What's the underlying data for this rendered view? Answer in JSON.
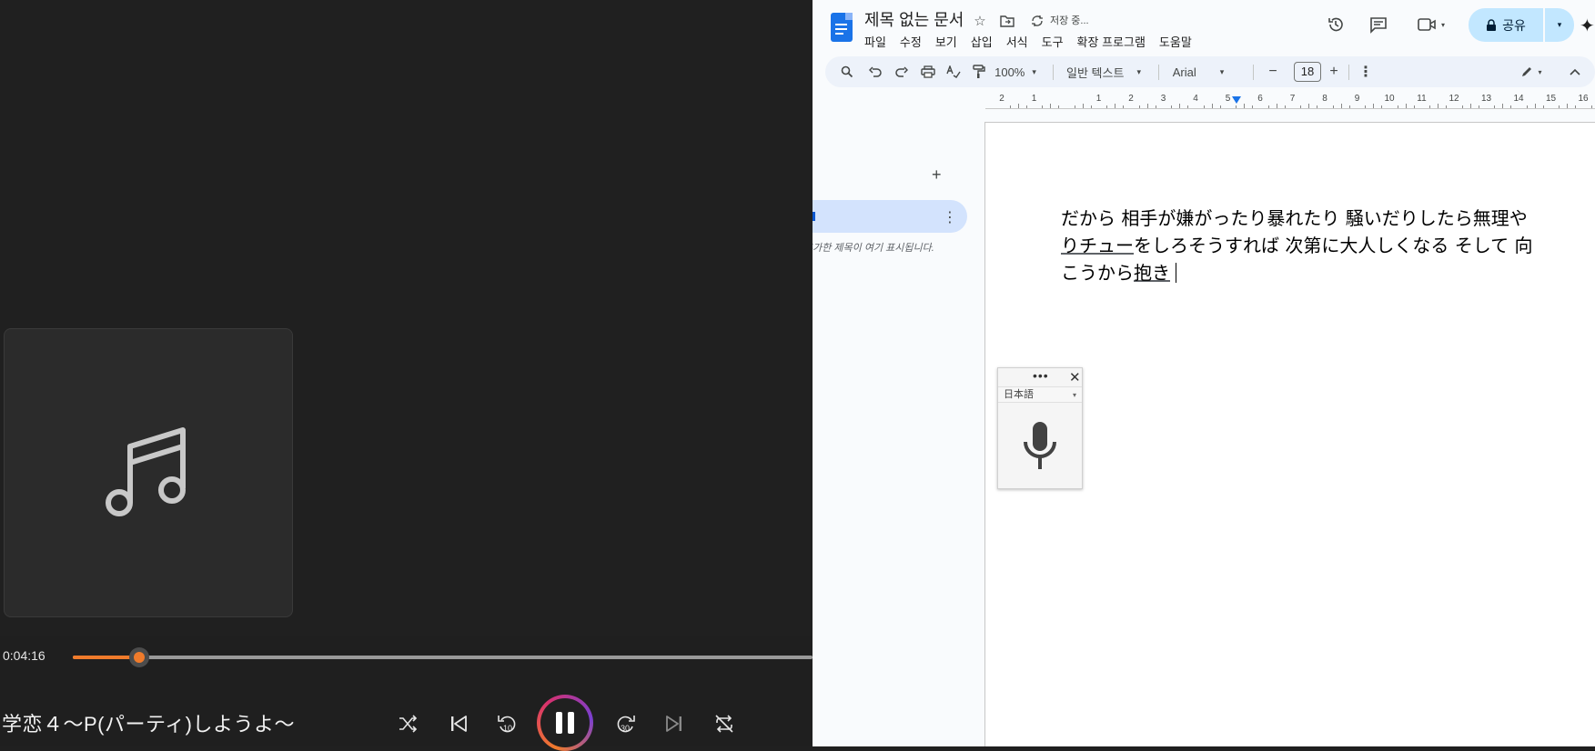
{
  "player": {
    "current_time": "0:04:16",
    "progress_fraction": 0.09,
    "track_title": "学恋４～P(パーティ)しようよ～",
    "accent_color": "#f07b2b",
    "icons": {
      "art": "music-note-icon",
      "shuffle": "shuffle-icon",
      "previous": "previous-track-icon",
      "rewind": "rewind-10-icon",
      "play_pause": "pause-icon",
      "forward": "forward-30-icon",
      "next": "next-track-icon",
      "repeat": "repeat-off-icon"
    },
    "rewind_label": "10",
    "forward_label": "30"
  },
  "docs": {
    "title": "제목 없는 문서",
    "save_status": "저장 중...",
    "menu": [
      "파일",
      "수정",
      "보기",
      "삽입",
      "서식",
      "도구",
      "확장 프로그램",
      "도움말"
    ],
    "share_label": "공유",
    "toolbar": {
      "zoom": "100%",
      "style": "일반 텍스트",
      "font": "Arial",
      "font_size": "18",
      "minus": "−",
      "plus": "+"
    },
    "ruler_numbers": [
      "2",
      "1",
      "",
      "1",
      "2",
      "3",
      "4",
      "5",
      "6",
      "7",
      "8",
      "9",
      "10",
      "11",
      "12",
      "13",
      "14",
      "15",
      "16"
    ],
    "outline": {
      "add": "+",
      "hint": "추가한 제목이 여기 표시됩니다."
    },
    "body": {
      "line1": "だから 相手が嫌がったり暴れたり 騒いだりしたら無理や",
      "line2_a": "りチュー",
      "line2_b": "をしろそうすれば 次第に大人しくなる そして 向",
      "line3_a": "こうから",
      "line3_b": "抱き"
    },
    "voice": {
      "language": "日本語",
      "more": "•••",
      "close": "✕"
    },
    "brand_color": "#1a73e8"
  }
}
